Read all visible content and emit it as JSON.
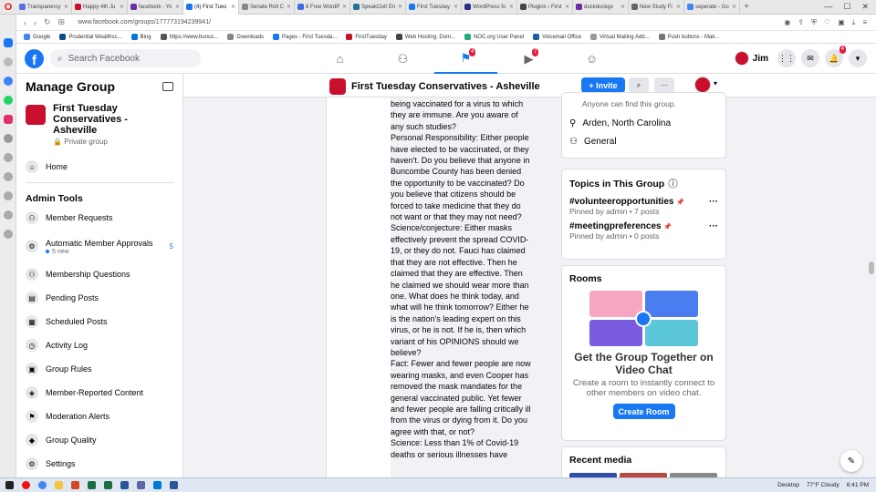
{
  "browser": {
    "tabs": [
      {
        "label": "Transparency",
        "color": "#5b6ee1"
      },
      {
        "label": "Happy 4th Ju",
        "color": "#c8102e"
      },
      {
        "label": "facebook - Yo",
        "color": "#6b2fa3"
      },
      {
        "label": "(4) First Tues",
        "color": "#1877f2"
      },
      {
        "label": "Senate Roll C",
        "color": "#888888"
      },
      {
        "label": "8 Free WordP",
        "color": "#4169e1"
      },
      {
        "label": "SpeakOut! En",
        "color": "#21759b"
      },
      {
        "label": "First Tuesday",
        "color": "#1877f2"
      },
      {
        "label": "WordPress fo",
        "color": "#2c2c8c"
      },
      {
        "label": "Plugins ‹ First",
        "color": "#444444"
      },
      {
        "label": "duckduckgo",
        "color": "#6b2fa3"
      },
      {
        "label": "New Study Fi",
        "color": "#666666"
      },
      {
        "label": "seperate - Go",
        "color": "#4285f4"
      }
    ],
    "url": "www.facebook.com/groups/177773194239941/",
    "bookmarks": [
      "Google",
      "Prudential Wealthsc...",
      "Bing",
      "https://www.bunco...",
      "Downloads",
      "Pages - First Tuesda...",
      "FirstTuesday",
      "Web Hosting, Dom...",
      "NOC.org User Panel",
      "Voicemail Office",
      "Virtual Mailing Add...",
      "Push buttons - Mak..."
    ]
  },
  "fb": {
    "search_placeholder": "Search Facebook",
    "user_name": "Jim",
    "badges": {
      "groups": "4",
      "watch": "7",
      "notifications": "4"
    }
  },
  "left": {
    "title": "Manage Group",
    "group_name": "First Tuesday Conservatives - Asheville",
    "privacy": "Private group",
    "home": "Home",
    "admin_tools": "Admin Tools",
    "items": [
      {
        "label": "Member Requests",
        "icon": "member-requests-icon"
      },
      {
        "label": "Automatic Member Approvals",
        "icon": "auto-approval-icon",
        "sub": "5 new",
        "count": "5"
      },
      {
        "label": "Membership Questions",
        "icon": "questions-icon"
      },
      {
        "label": "Pending Posts",
        "icon": "pending-posts-icon"
      },
      {
        "label": "Scheduled Posts",
        "icon": "scheduled-posts-icon"
      },
      {
        "label": "Activity Log",
        "icon": "activity-log-icon"
      },
      {
        "label": "Group Rules",
        "icon": "group-rules-icon"
      },
      {
        "label": "Member-Reported Content",
        "icon": "reported-content-icon"
      },
      {
        "label": "Moderation Alerts",
        "icon": "moderation-alerts-icon"
      },
      {
        "label": "Group Quality",
        "icon": "group-quality-icon"
      },
      {
        "label": "Settings",
        "icon": "settings-icon"
      }
    ]
  },
  "header": {
    "group_title": "First Tuesday Conservatives - Asheville",
    "invite": "+ Invite"
  },
  "post": {
    "text": "being vaccinated for a virus to which they are immune. Are you aware of any such studies?\nPersonal Responsibility: Either people have elected to be vaccinated, or they haven't. Do you believe that anyone in Buncombe County has been denied the opportunity to be vaccinated? Do you believe that citizens should be forced to take medicine that they do not want or that they may not need?\nScience/conjecture: Either masks effectively prevent the spread COVID-19, or they do not. Fauci has claimed that they are not effective. Then he claimed that they are effective. Then he claimed we should wear more than one. What does he think today, and what will he think tomorrow? Either he is the nation's leading expert on this virus, or he is not. If he is, then which variant of his OPINIONS should we believe?\nFact: Fewer and fewer people are now wearing masks, and even Cooper has removed the mask mandates for the general vaccinated public. Yet fewer and fewer people are falling critically ill from the virus or dying from it. Do you agree with that, or not?\nScience: Less than 1% of Covid-19 deaths or serious illnesses have"
  },
  "right": {
    "about_find": "Anyone can find this group.",
    "location": "Arden, North Carolina",
    "category": "General",
    "topics_title": "Topics in This Group",
    "topics": [
      {
        "name": "#volunteeropportunities",
        "sub": "Pinned by admin • 7 posts"
      },
      {
        "name": "#meetingpreferences",
        "sub": "Pinned by admin • 0 posts"
      }
    ],
    "rooms_title": "Rooms",
    "rooms_heading": "Get the Group Together on Video Chat",
    "rooms_desc": "Create a room to instantly connect to other members on video chat.",
    "create_room": "Create Room",
    "recent_media": "Recent media"
  },
  "taskbar": {
    "desktop": "Desktop",
    "weather": "77°F Cloudy",
    "time": "6:41 PM"
  }
}
